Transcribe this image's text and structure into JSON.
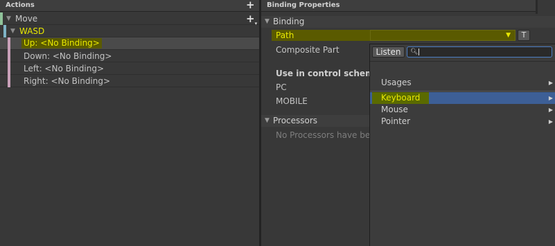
{
  "actions_panel": {
    "title": "Actions",
    "action": {
      "name": "Move"
    },
    "composite": {
      "name": "WASD"
    },
    "bindings": [
      {
        "label": "Up: <No Binding>",
        "selected": true
      },
      {
        "label": "Down: <No Binding>",
        "selected": false
      },
      {
        "label": "Left: <No Binding>",
        "selected": false
      },
      {
        "label": "Right: <No Binding>",
        "selected": false
      }
    ]
  },
  "properties_panel": {
    "title": "Binding Properties",
    "binding_section": "Binding",
    "path_label": "Path",
    "t_button": "T",
    "composite_part_label": "Composite Part",
    "control_scheme_header": "Use in control scheme",
    "schemes": [
      "PC",
      "MOBILE"
    ],
    "processors_section": "Processors",
    "processors_empty": "No Processors have bee"
  },
  "path_picker": {
    "listen_button": "Listen",
    "search_value": "",
    "items": [
      {
        "label": "Usages",
        "has_submenu": true,
        "selected": false
      },
      {
        "label": "Keyboard",
        "has_submenu": true,
        "selected": true
      },
      {
        "label": "Mouse",
        "has_submenu": true,
        "selected": false
      },
      {
        "label": "Pointer",
        "has_submenu": true,
        "selected": false
      }
    ]
  },
  "colors": {
    "highlight_text": "#e8e800",
    "highlight_bg": "#5a5a00",
    "selection_blue": "#3d5f96",
    "action_stripe": "#8fc39a",
    "composite_stripe": "#7fb3c6",
    "binding_stripe": "#c8a0b8"
  }
}
